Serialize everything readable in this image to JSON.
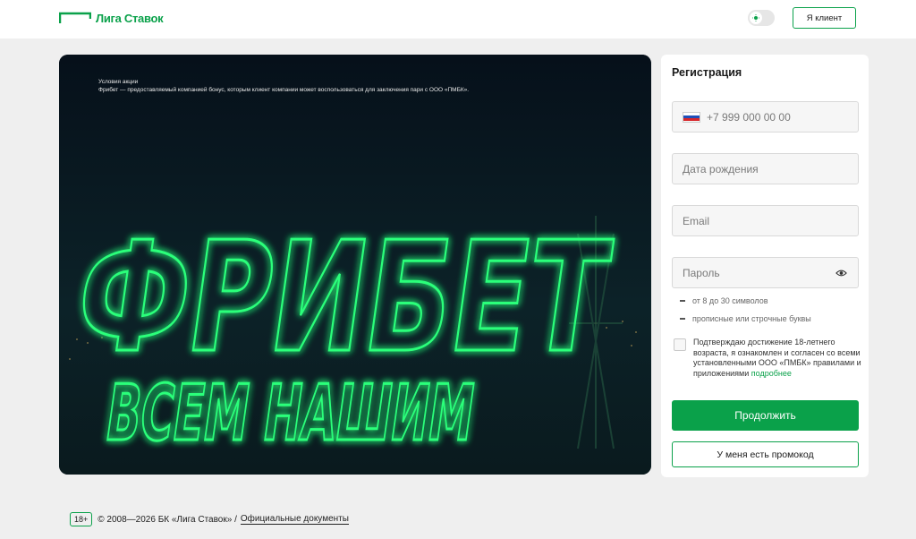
{
  "header": {
    "logo_text": "Лига Ставок",
    "client_button": "Я клиент",
    "theme_icon": "sun-icon"
  },
  "banner": {
    "terms_title": "Условия акции",
    "terms_text": "Фрибет — предоставляемый компанией бонус, которым клиент компании может воспользоваться для заключения пари с ООО «ПМБК».",
    "headline": "ФРИБЕТ",
    "subheadline": "ВСЕМ НАШИМ",
    "neon_color": "#2bff7a"
  },
  "form": {
    "title": "Регистрация",
    "phone_placeholder": "+7 999 000 00 00",
    "birthdate_placeholder": "Дата рождения",
    "email_placeholder": "Email",
    "password_placeholder": "Пароль",
    "hints": [
      "от 8 до 30 символов",
      "прописные или строчные буквы"
    ],
    "agree_text": "Подтверждаю достижение 18-летнего возраста, я ознакомлен и согласен со всеми установленными ООО «ПМБК» правилами и приложениями",
    "agree_link": "подробнее",
    "continue_button": "Продолжить",
    "promo_button": "У меня есть промокод"
  },
  "footer": {
    "age": "18+",
    "copyright": "© 2008—2026 БК «Лига Ставок» / ",
    "docs_link": "Официальные документы"
  },
  "colors": {
    "accent": "#0aa14a",
    "background": "#efefef"
  }
}
